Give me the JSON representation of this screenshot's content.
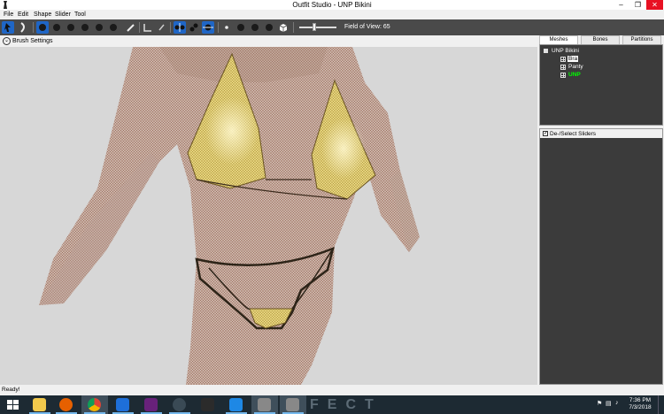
{
  "window": {
    "title": "Outfit Studio - UNP Bikini"
  },
  "menu": [
    "File",
    "Edit",
    "Shape",
    "Slider",
    "Tool"
  ],
  "toolbar": {
    "fov_label": "Field of View: 65",
    "fov_slider_fraction": 0.4
  },
  "brush": {
    "label": "Brush Settings"
  },
  "panel": {
    "tabs": [
      "Meshes",
      "Bones",
      "Partitions"
    ],
    "tree_root": "UNP Bikini",
    "meshes": [
      {
        "label": "Bra",
        "selected": true,
        "color": "#000000"
      },
      {
        "label": "Panty",
        "selected": false,
        "color": "#ffffff"
      },
      {
        "label": "UNP",
        "selected": false,
        "color": "#00ff00"
      }
    ],
    "sliders_header": "De-/Select Sliders"
  },
  "status": {
    "text": "Ready!"
  },
  "taskbar": {
    "watermark": "FECT",
    "time": "7:36 PM",
    "date": "7/3/2018"
  },
  "colors": {
    "accent": "#1f66c6",
    "close_red": "#e81123",
    "taskbar": "#1d2a33"
  }
}
